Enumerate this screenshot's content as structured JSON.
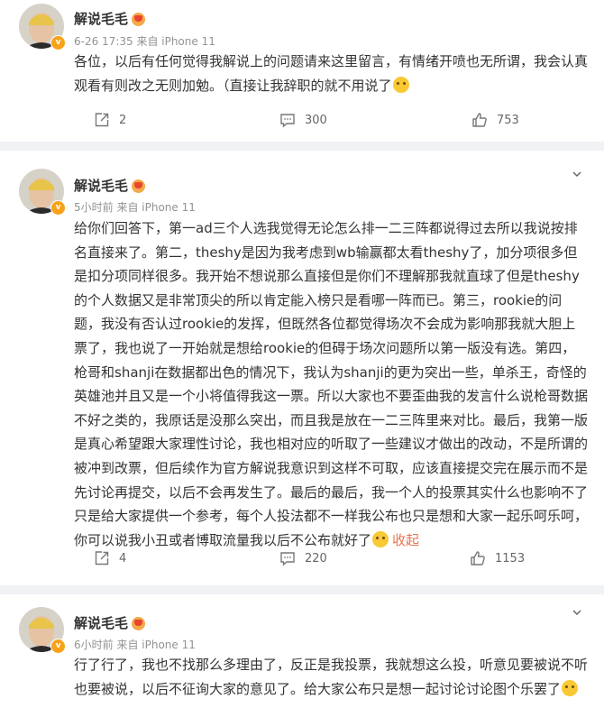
{
  "colors": {
    "accent": "#eb7350",
    "meta": "#939393",
    "verified": "#f7a21a"
  },
  "posts": [
    {
      "author": "解说毛毛",
      "meta": "6-26 17:35  来自 iPhone 11",
      "content": "各位，以后有任何觉得我解说上的问题请来这里留言，有情绪开喷也无所谓，我会认真观看有则改之无则加勉。（直接让我辞职的就不用说了",
      "repost_count": "2",
      "comment_count": "300",
      "like_count": "753"
    },
    {
      "author": "解说毛毛",
      "meta": "5小时前  来自 iPhone 11",
      "content": "给你们回答下，第一ad三个人选我觉得无论怎么排一二三阵都说得过去所以我说按排名直接来了。第二，theshy是因为我考虑到wb输赢都太看theshy了，加分项很多但是扣分项同样很多。我开始不想说那么直接但是你们不理解那我就直球了但是theshy的个人数据又是非常顶尖的所以肯定能入榜只是看哪一阵而已。第三，rookie的问题，我没有否认过rookie的发挥，但既然各位都觉得场次不会成为影响那我就大胆上票了，我也说了一开始就是想给rookie的但碍于场次问题所以第一版没有选。第四，枪哥和shanji在数据都出色的情况下，我认为shanji的更为突出一些，单杀王，奇怪的英雄池并且又是一个小将值得我这一票。所以大家也不要歪曲我的发言什么说枪哥数据不好之类的，我原话是没那么突出，而且我是放在一二三阵里来对比。最后，我第一版是真心希望跟大家理性讨论，我也相对应的听取了一些建议才做出的改动，不是所谓的被冲到改票，但后续作为官方解说我意识到这样不可取，应该直接提交完在展示而不是先讨论再提交，以后不会再发生了。最后的最后，我一个人的投票其实什么也影响不了只是给大家提供一个参考，每个人投法都不一样我公布也只是想和大家一起乐呵乐呵，你可以说我小丑或者博取流量我以后不公布就好了",
      "collapse_label": "收起",
      "repost_count": "4",
      "comment_count": "220",
      "like_count": "1153"
    },
    {
      "author": "解说毛毛",
      "meta": "6小时前  来自 iPhone 11",
      "content": "行了行了，我也不找那么多理由了，反正是我投票，我就想这么投，听意见要被说不听也要被说，以后不征询大家的意见了。给大家公布只是想一起讨论讨论图个乐罢了"
    }
  ],
  "icons": {
    "repost": "repost-icon",
    "comment": "comment-icon",
    "like": "like-icon",
    "more": "chevron-down-icon",
    "verified": "verified-badge-icon"
  }
}
